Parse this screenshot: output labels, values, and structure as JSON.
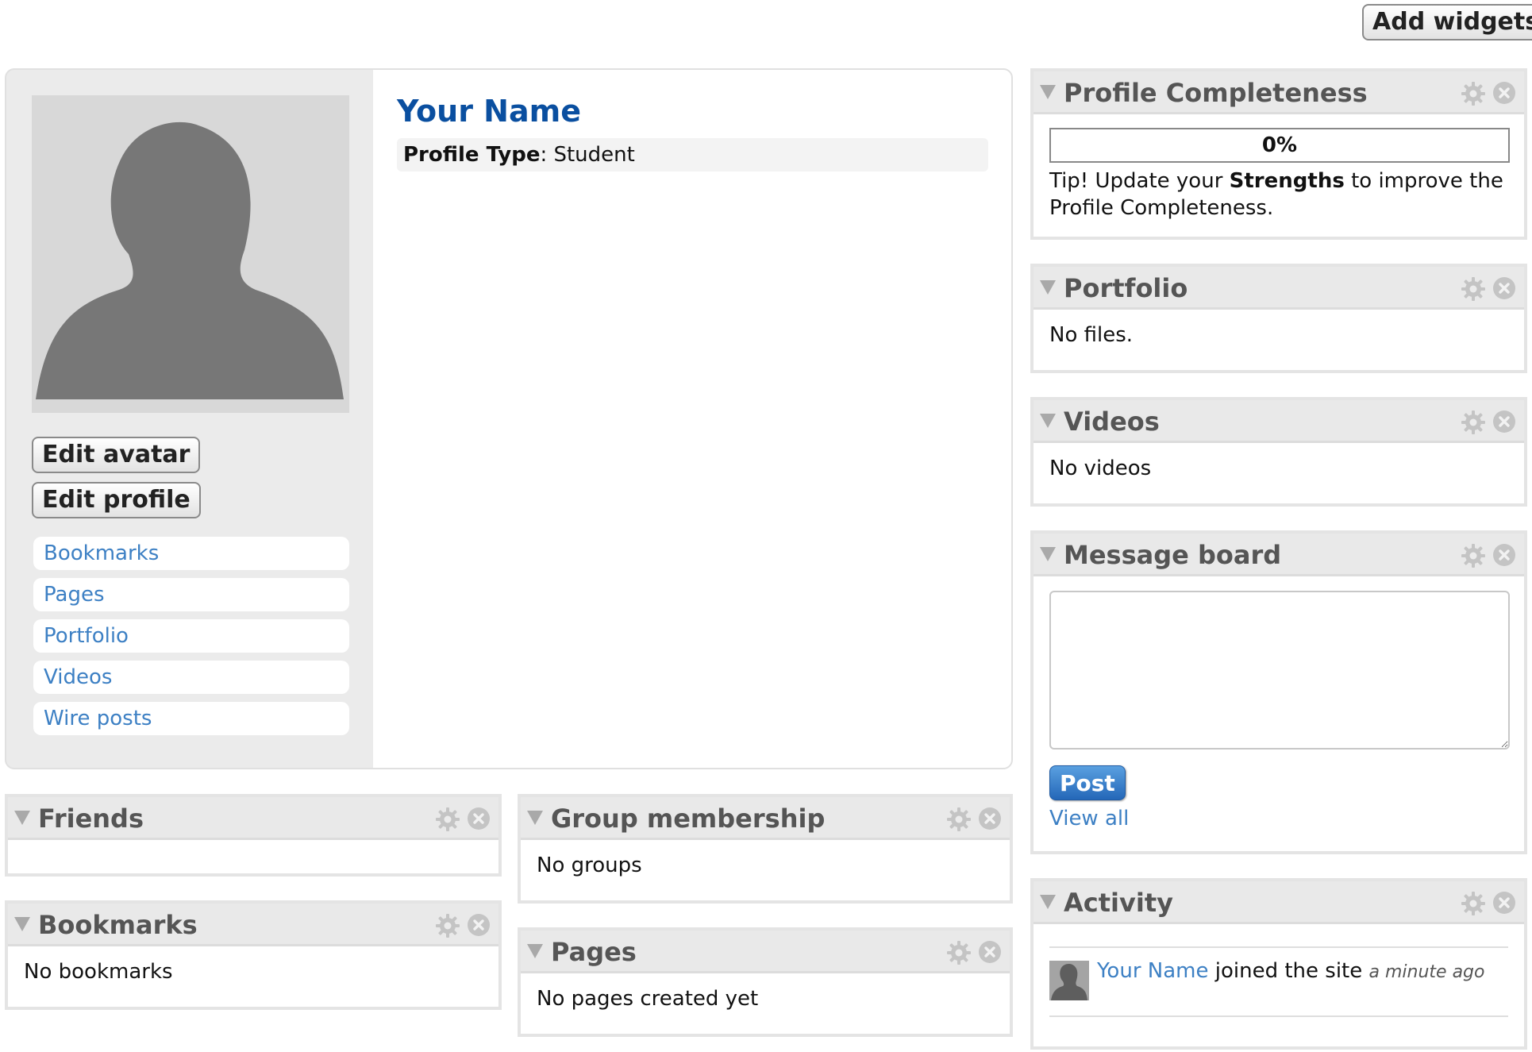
{
  "top_bar": {
    "add_widgets_label": "Add widgets"
  },
  "owner_block": {
    "edit_avatar_label": "Edit avatar",
    "edit_profile_label": "Edit profile",
    "menu_items": [
      {
        "label": "Bookmarks"
      },
      {
        "label": "Pages"
      },
      {
        "label": "Portfolio"
      },
      {
        "label": "Videos"
      },
      {
        "label": "Wire posts"
      }
    ],
    "name": "Your Name",
    "profile_type_label": "Profile Type",
    "profile_type_value": "Student"
  },
  "widgets": {
    "profile_completeness": {
      "title": "Profile Completeness",
      "progress_percent": 0,
      "progress_text": "0%",
      "tip_prefix": "Tip! Update your ",
      "tip_strong": "Strengths",
      "tip_suffix": " to improve the Profile Completeness."
    },
    "portfolio": {
      "title": "Portfolio",
      "text": "No files."
    },
    "videos": {
      "title": "Videos",
      "text": "No videos"
    },
    "message_board": {
      "title": "Message board",
      "post_label": "Post",
      "view_all_label": "View all"
    },
    "activity": {
      "title": "Activity",
      "user": "Your Name",
      "action": " joined the site ",
      "time": "a minute ago"
    },
    "friends": {
      "title": "Friends"
    },
    "bookmarks": {
      "title": "Bookmarks",
      "text": "No bookmarks"
    },
    "group_membership": {
      "title": "Group membership",
      "text": "No groups"
    },
    "pages": {
      "title": "Pages",
      "text": "No pages created yet"
    }
  },
  "icons": {
    "collapse": "collapse-triangle-icon",
    "settings": "gear-icon",
    "close": "close-icon",
    "avatar": "default-avatar-silhouette"
  },
  "colors": {
    "name_heading": "#0a4fa0",
    "link": "#3d80c4",
    "post_button": "#2467b8",
    "widget_header": "#e9e9e9",
    "owner_sidebar": "#ebebeb"
  }
}
